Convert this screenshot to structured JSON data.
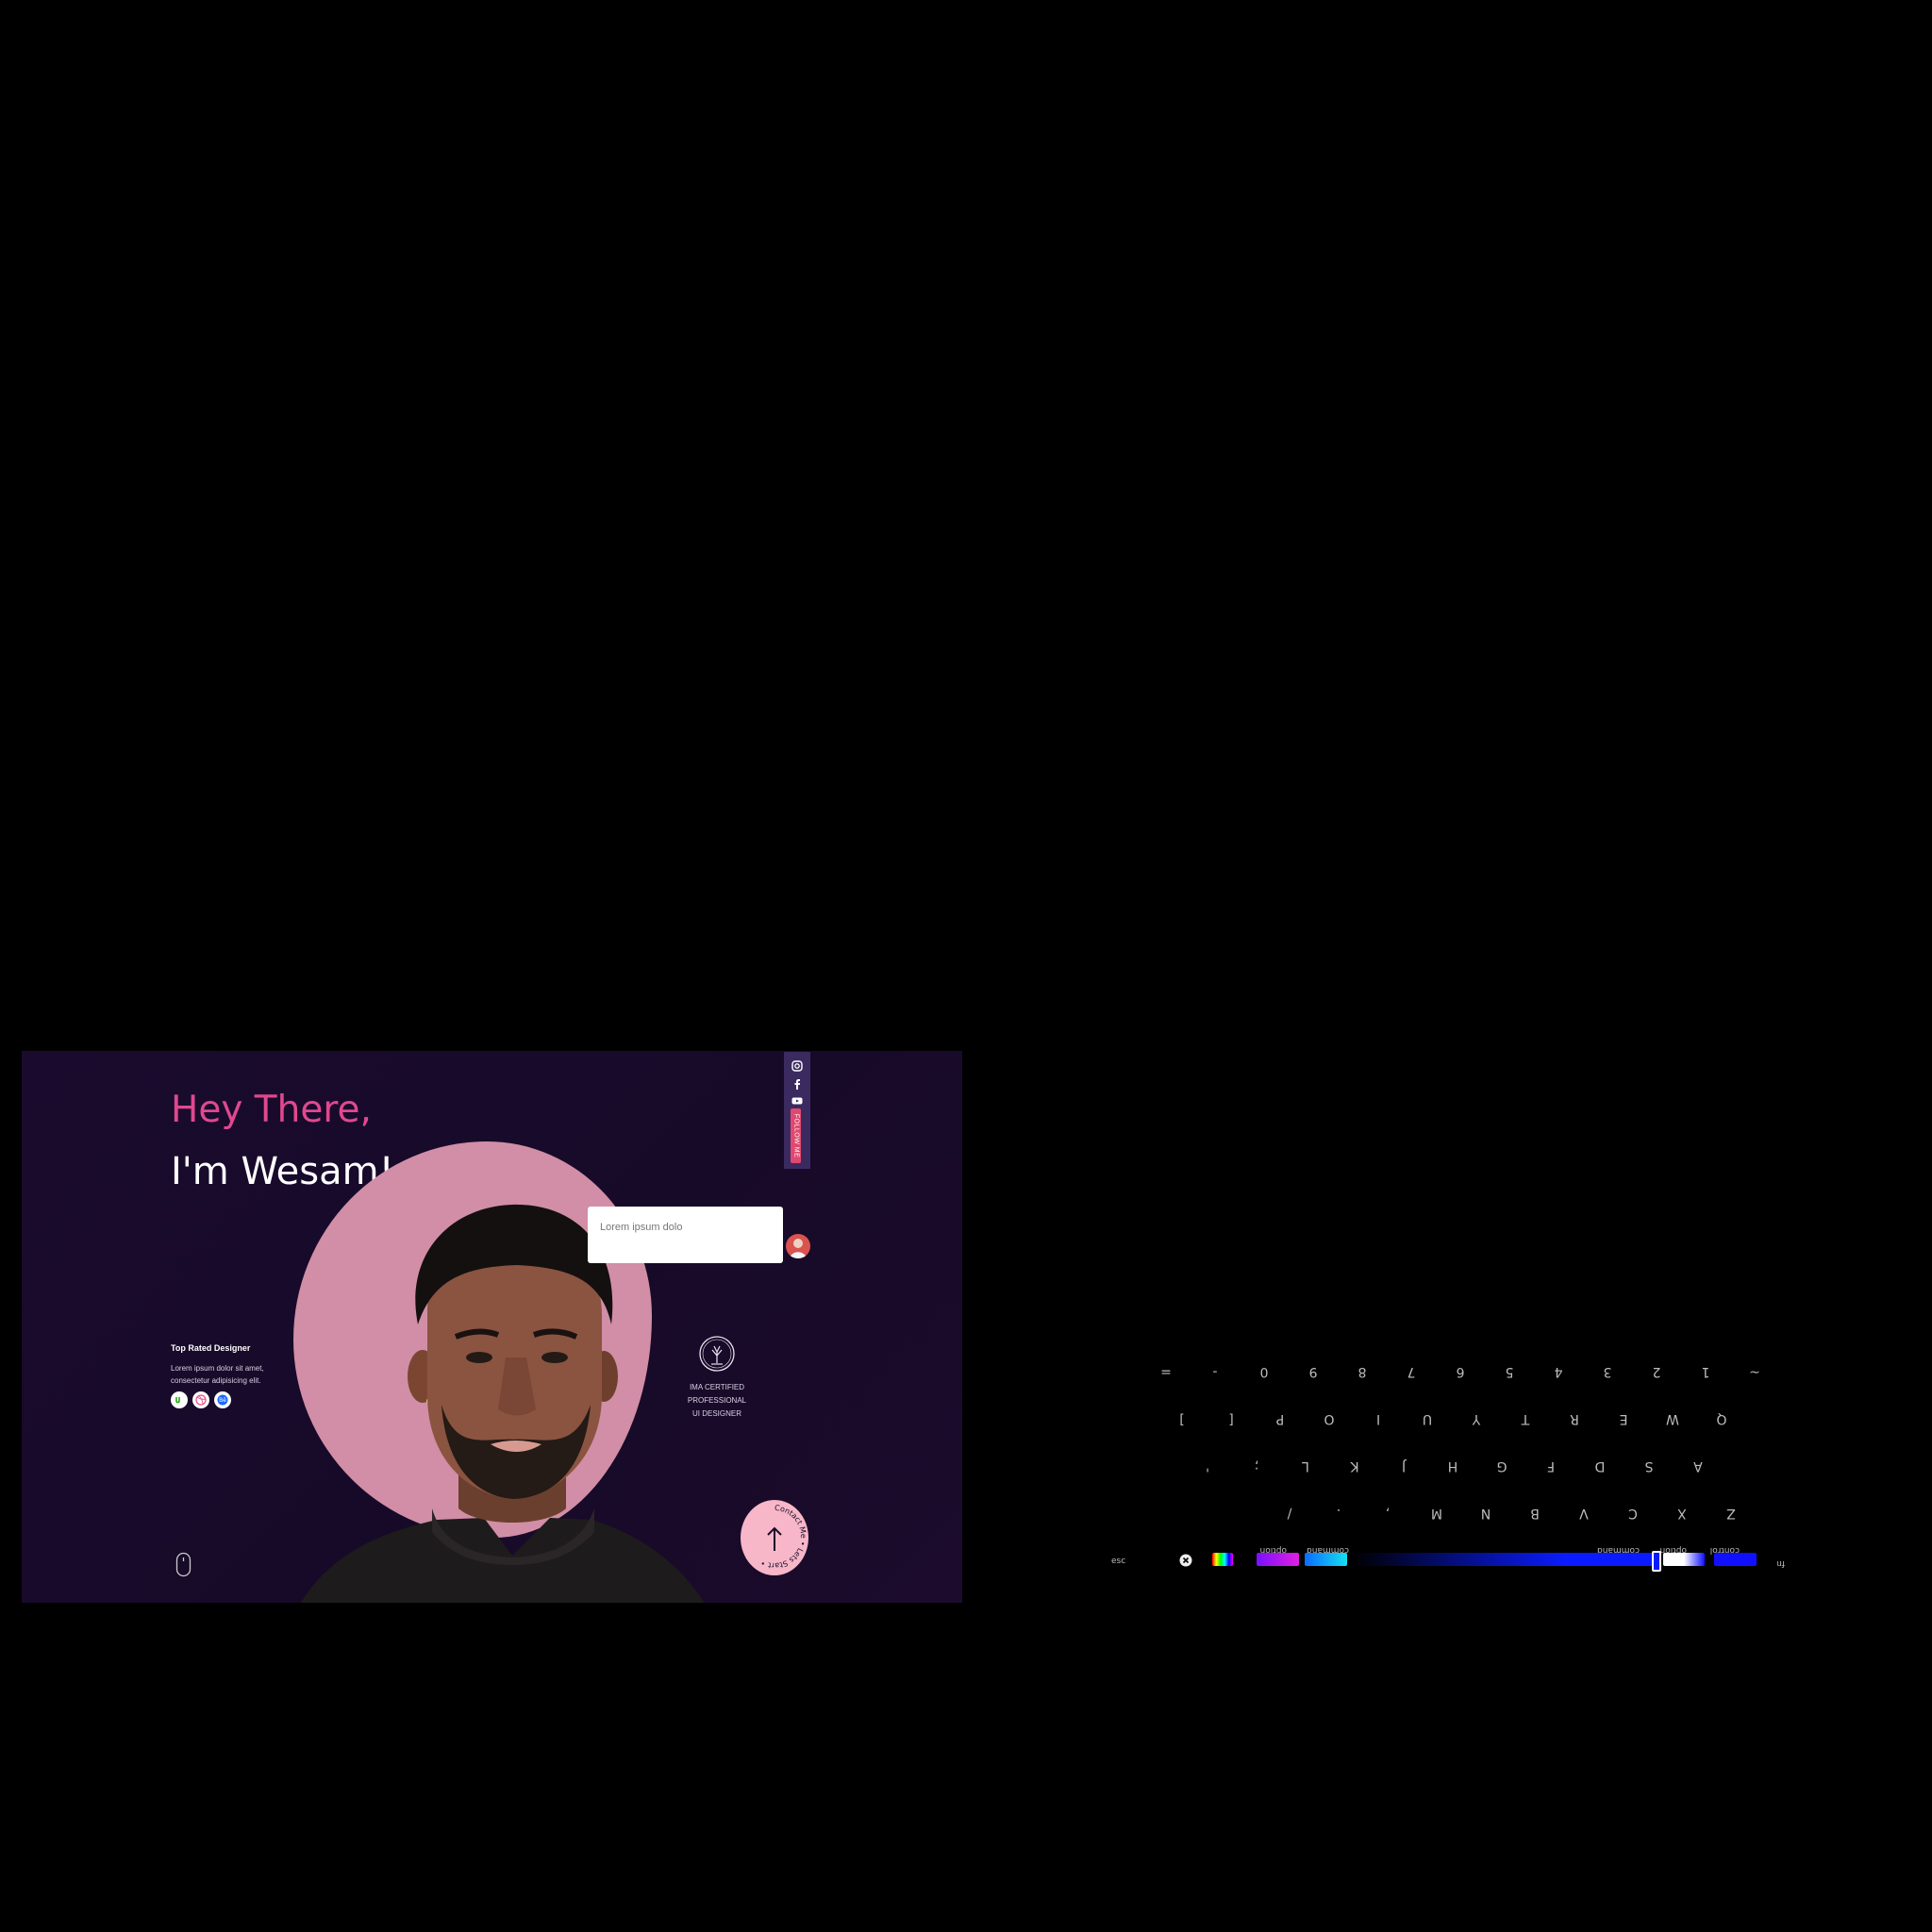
{
  "site": {
    "greeting": "Hey There,",
    "name": "I'm Wesam!",
    "bubble_text": "Lorem ipsum dolo",
    "follow": {
      "label": "FOLLOW ME",
      "icons": [
        "instagram-icon",
        "facebook-icon",
        "youtube-icon"
      ]
    },
    "top_rated": {
      "title": "Top Rated Designer",
      "desc": "Lorem ipsum dolor sit amet, consectetur adipisicing elit.",
      "icons": [
        "upwork-icon",
        "dribbble-icon",
        "behance-icon"
      ]
    },
    "cert": {
      "line1": "IMA CERTIFIED",
      "line2": "PROFESSIONAL",
      "line3": "UI DESIGNER"
    },
    "contact_label": "Contact Me • Lets Start •",
    "colors": {
      "accent": "#e0488f",
      "blob": "#d18ea6",
      "background": "#1a0b2e",
      "contact_circle": "#f7b7c8"
    }
  },
  "keyboard": {
    "row_numbers": [
      "~",
      "1",
      "2",
      "3",
      "4",
      "5",
      "6",
      "7",
      "8",
      "9",
      "0",
      "-",
      "="
    ],
    "row_top": [
      "Q",
      "W",
      "E",
      "R",
      "T",
      "Y",
      "U",
      "I",
      "O",
      "P",
      "[",
      "]"
    ],
    "row_home": [
      "A",
      "S",
      "D",
      "F",
      "G",
      "H",
      "J",
      "K",
      "L",
      ";",
      "'"
    ],
    "row_bottom": [
      "Z",
      "X",
      "C",
      "V",
      "B",
      "N",
      "M",
      ",",
      ".",
      "/"
    ],
    "modifiers": {
      "esc": "esc",
      "fn": "fn",
      "control": "control",
      "option_left": "option",
      "command_left": "command",
      "command_right": "command",
      "option_right": "option"
    },
    "swatch_colors": [
      "#e020e0",
      "#16e0f0",
      "#0a1cff",
      "#ffffff",
      "#1010ff"
    ]
  }
}
